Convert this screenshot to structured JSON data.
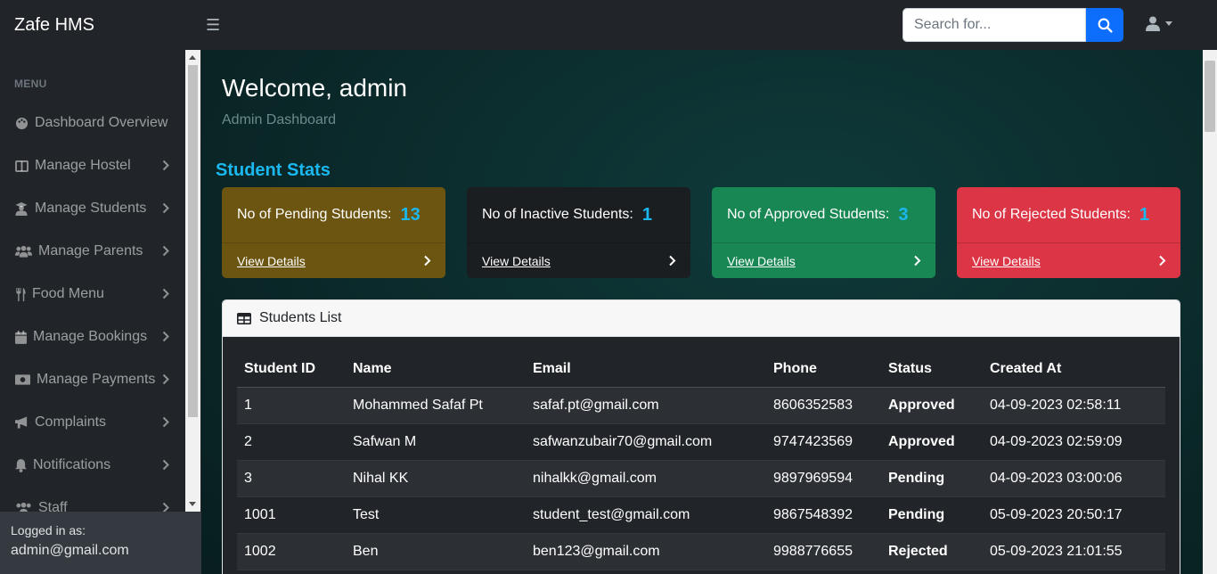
{
  "app": {
    "title": "Zafe HMS"
  },
  "search": {
    "placeholder": "Search for..."
  },
  "sidebar": {
    "heading": "MENU",
    "items": [
      {
        "label": "Dashboard Overview",
        "icon": "palette-icon",
        "has_chevron": false
      },
      {
        "label": "Manage Hostel",
        "icon": "columns-icon",
        "has_chevron": true
      },
      {
        "label": "Manage Students",
        "icon": "user-graduate-icon",
        "has_chevron": true
      },
      {
        "label": "Manage Parents",
        "icon": "users-icon",
        "has_chevron": true
      },
      {
        "label": "Food Menu",
        "icon": "utensils-icon",
        "has_chevron": true
      },
      {
        "label": "Manage Bookings",
        "icon": "calendar-icon",
        "has_chevron": true
      },
      {
        "label": "Manage Payments",
        "icon": "money-icon",
        "has_chevron": true
      },
      {
        "label": "Complaints",
        "icon": "bullhorn-icon",
        "has_chevron": true
      },
      {
        "label": "Notifications",
        "icon": "bell-icon",
        "has_chevron": true
      },
      {
        "label": "Staff",
        "icon": "users-icon",
        "has_chevron": true
      }
    ],
    "footer": {
      "label": "Logged in as:",
      "user": "admin@gmail.com"
    }
  },
  "main": {
    "title": "Welcome, admin",
    "subtitle": "Admin Dashboard",
    "section_title": "Student Stats",
    "stats": [
      {
        "label": "No of Pending Students:",
        "count": "13",
        "link": "View Details",
        "color": "#6b5510"
      },
      {
        "label": "No of Inactive Students:",
        "count": "1",
        "link": "View Details",
        "color": "#1b1e21"
      },
      {
        "label": "No of Approved Students:",
        "count": "3",
        "link": "View Details",
        "color": "#198754"
      },
      {
        "label": "No of Rejected Students:",
        "count": "1",
        "link": "View Details",
        "color": "#dc3545"
      }
    ],
    "table": {
      "title": "Students List",
      "columns": [
        "Student ID",
        "Name",
        "Email",
        "Phone",
        "Status",
        "Created At"
      ],
      "rows": [
        {
          "id": "1",
          "name": "Mohammed Safaf Pt",
          "email": "safaf.pt@gmail.com",
          "phone": "8606352583",
          "status": "Approved",
          "created": "04-09-2023 02:58:11"
        },
        {
          "id": "2",
          "name": "Safwan M",
          "email": "safwanzubair70@gmail.com",
          "phone": "9747423569",
          "status": "Approved",
          "created": "04-09-2023 02:59:09"
        },
        {
          "id": "3",
          "name": "Nihal KK",
          "email": "nihalkk@gmail.com",
          "phone": "9897969594",
          "status": "Pending",
          "created": "04-09-2023 03:00:06"
        },
        {
          "id": "1001",
          "name": "Test",
          "email": "student_test@gmail.com",
          "phone": "9867548392",
          "status": "Pending",
          "created": "05-09-2023 20:50:17"
        },
        {
          "id": "1002",
          "name": "Ben",
          "email": "ben123@gmail.com",
          "phone": "9988776655",
          "status": "Rejected",
          "created": "05-09-2023 21:01:55"
        }
      ]
    }
  },
  "colors": {
    "accent": "#1bb8f0",
    "primary": "#0d6efd",
    "approved": "#28a745",
    "pending": "#f0a020",
    "rejected": "#dc3545"
  }
}
